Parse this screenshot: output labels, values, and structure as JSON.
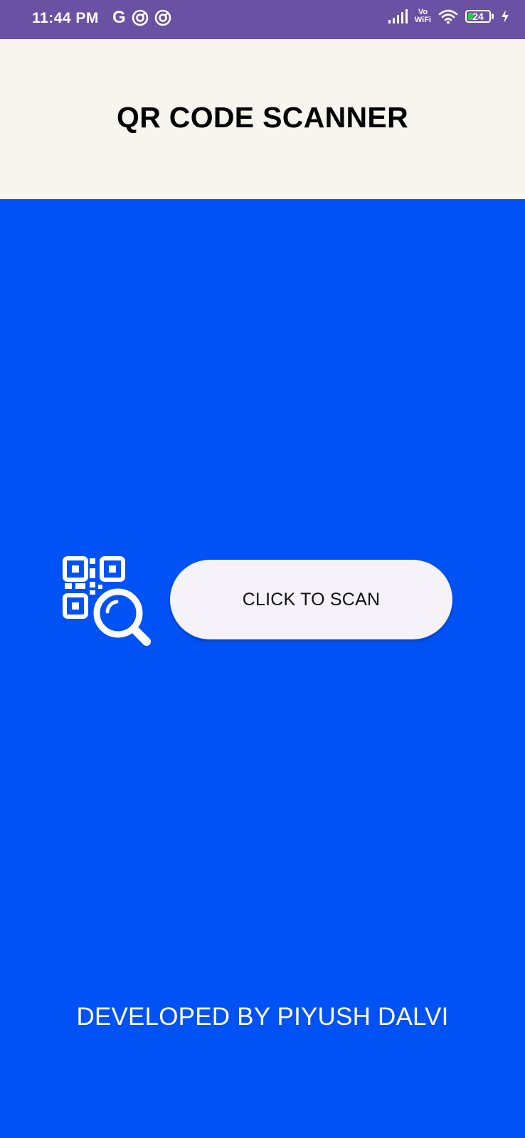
{
  "colors": {
    "status_bar": "#6b51a3",
    "header_bg": "#f8f5ee",
    "main_bg": "#0052f5",
    "button_bg": "#f5f2f9",
    "battery_fill": "#35c84a"
  },
  "status_bar": {
    "time": "11:44 PM",
    "google_letter": "G",
    "left_icons": [
      "google-icon",
      "app-notification-icon",
      "app-notification-icon"
    ],
    "right_icons": [
      "signal-icon",
      "vowifi-icon",
      "wifi-icon",
      "battery-icon",
      "charging-icon"
    ],
    "vo_label": "Vo",
    "wifi_label": "WiFi",
    "battery_level": "24"
  },
  "header": {
    "title": "QR CODE SCANNER"
  },
  "main": {
    "icon": "qr-search-icon",
    "scan_button_label": "CLICK TO SCAN"
  },
  "footer": {
    "credit": "DEVELOPED BY PIYUSH DALVI"
  }
}
